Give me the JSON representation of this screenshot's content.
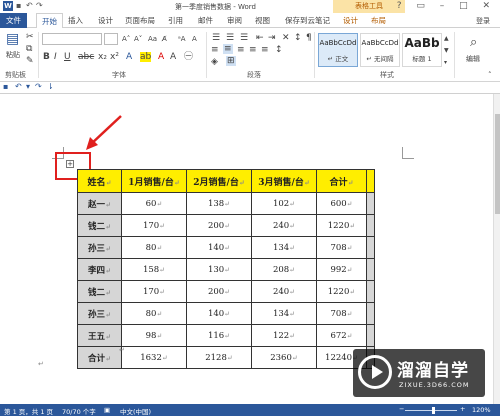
{
  "titlebar": {
    "title": "第一季度销售数据 - Word",
    "context_tab": "表格工具",
    "win_controls": "? ▭ – □ ✕"
  },
  "tabs": [
    {
      "label": "文件"
    },
    {
      "label": "开始"
    },
    {
      "label": "插入"
    },
    {
      "label": "设计"
    },
    {
      "label": "页面布局"
    },
    {
      "label": "引用"
    },
    {
      "label": "邮件"
    },
    {
      "label": "审阅"
    },
    {
      "label": "视图"
    },
    {
      "label": "保存到云笔记"
    },
    {
      "label": "设计"
    },
    {
      "label": "布局"
    }
  ],
  "signin": "登录",
  "ribbon": {
    "clipboard": {
      "paste_label": "粘贴",
      "group_label": "剪贴板"
    },
    "font": {
      "group_label": "字体"
    },
    "paragraph": {
      "group_label": "段落"
    },
    "styles": {
      "group_label": "样式",
      "items": [
        {
          "sample": "AaBbCcDd",
          "name": "↵ 正文"
        },
        {
          "sample": "AaBbCcDd",
          "name": "↵ 无间隔"
        },
        {
          "sample": "AaBb",
          "name": "标题 1"
        }
      ]
    },
    "editing": {
      "label": "编辑"
    }
  },
  "table": {
    "headers": [
      "姓名",
      "1月销售/台",
      "2月销售/台",
      "3月销售/台",
      "合计"
    ],
    "rows": [
      [
        "赵一",
        "60",
        "138",
        "102",
        "600"
      ],
      [
        "钱二",
        "170",
        "200",
        "240",
        "1220"
      ],
      [
        "孙三",
        "80",
        "140",
        "134",
        "708"
      ],
      [
        "李四",
        "158",
        "130",
        "208",
        "992"
      ],
      [
        "钱二",
        "170",
        "200",
        "240",
        "1220"
      ],
      [
        "孙三",
        "80",
        "140",
        "134",
        "708"
      ],
      [
        "王五",
        "98",
        "116",
        "122",
        "672"
      ],
      [
        "合计",
        "1632",
        "2128",
        "2360",
        "12240"
      ]
    ]
  },
  "statusbar": {
    "page": "第 1 页，共 1 页",
    "words": "70/70 个字",
    "language": "中文(中国)",
    "zoom": "120%"
  },
  "watermark": {
    "text": "溜溜自学",
    "url": "ZIXUE.3D66.COM"
  },
  "colors": {
    "accent": "#2b579a",
    "header_fill": "#ffee00",
    "highlight_box": "#e0201e"
  }
}
